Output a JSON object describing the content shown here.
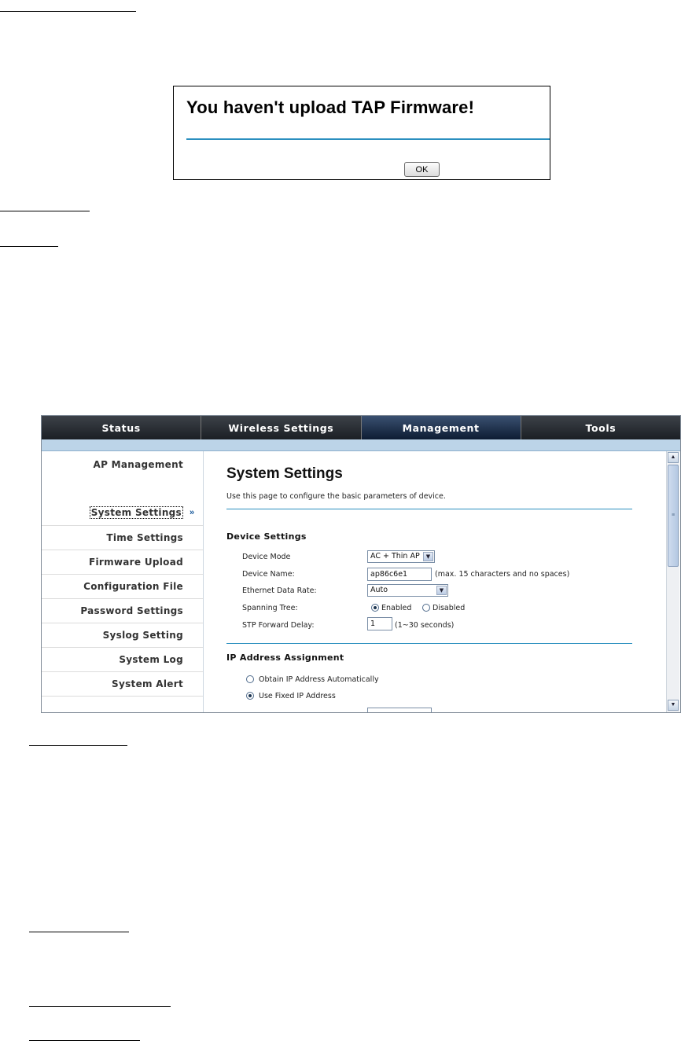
{
  "alert": {
    "message": "You haven't upload TAP Firmware!",
    "ok_label": "OK"
  },
  "tabs": [
    {
      "label": "Status"
    },
    {
      "label": "Wireless Settings"
    },
    {
      "label": "Management"
    },
    {
      "label": "Tools"
    }
  ],
  "active_tab": "Management",
  "sidebar": {
    "heading": "AP Management",
    "items": [
      {
        "label": "System Settings"
      },
      {
        "label": "Time Settings"
      },
      {
        "label": "Firmware Upload"
      },
      {
        "label": "Configuration File"
      },
      {
        "label": "Password Settings"
      },
      {
        "label": "Syslog Setting"
      },
      {
        "label": "System Log"
      },
      {
        "label": "System Alert"
      }
    ],
    "active_arrow": "»"
  },
  "page": {
    "title": "System Settings",
    "description": "Use this page to configure the basic parameters of device."
  },
  "device_settings": {
    "title": "Device Settings",
    "device_mode_label": "Device Mode",
    "device_mode_value": "AC + Thin AP",
    "device_name_label": "Device Name:",
    "device_name_value": "ap86c6e1",
    "device_name_hint": "(max. 15 characters and no spaces)",
    "eth_rate_label": "Ethernet Data Rate:",
    "eth_rate_value": "Auto",
    "spanning_tree_label": "Spanning Tree:",
    "spanning_enabled": "Enabled",
    "spanning_disabled": "Disabled",
    "stp_delay_label": "STP Forward Delay:",
    "stp_delay_value": "1",
    "stp_delay_hint": "(1~30 seconds)"
  },
  "ip_assignment": {
    "title": "IP Address Assignment",
    "obtain_auto": "Obtain IP Address Automatically",
    "use_fixed": "Use Fixed IP Address"
  }
}
